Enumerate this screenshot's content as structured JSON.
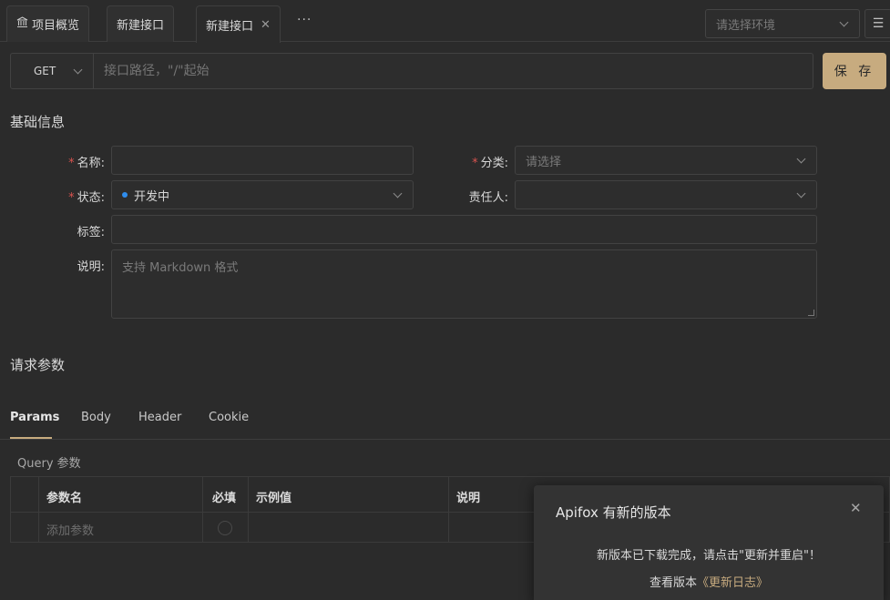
{
  "tabs": [
    {
      "label": "项目概览",
      "icon": "bank-icon"
    },
    {
      "label": "新建接口"
    },
    {
      "label": "新建接口",
      "active": true
    }
  ],
  "more_label": "···",
  "env_select": {
    "placeholder": "请选择环境"
  },
  "request": {
    "method": "GET",
    "path_placeholder": "接口路径，\"/\"起始",
    "save_label": "保 存"
  },
  "basic_info": {
    "title": "基础信息",
    "name_label": "名称:",
    "category_label": "分类:",
    "category_placeholder": "请选择",
    "status_label": "状态:",
    "status_value": "开发中",
    "status_color": "#2f8ded",
    "owner_label": "责任人:",
    "tags_label": "标签:",
    "desc_label": "说明:",
    "desc_placeholder": "支持 Markdown 格式"
  },
  "request_params": {
    "title": "请求参数",
    "tabs": [
      "Params",
      "Body",
      "Header",
      "Cookie"
    ],
    "active_tab": "Params",
    "query_label": "Query 参数",
    "columns": [
      "参数名",
      "必填",
      "示例值",
      "说明"
    ],
    "add_placeholder": "添加参数"
  },
  "notification": {
    "title": "Apifox 有新的版本",
    "message": "新版本已下载完成，请点击\"更新并重启\"！",
    "link_prefix": "查看版本",
    "link_text": "《更新日志》"
  },
  "accent_color": "#c7ab7f"
}
